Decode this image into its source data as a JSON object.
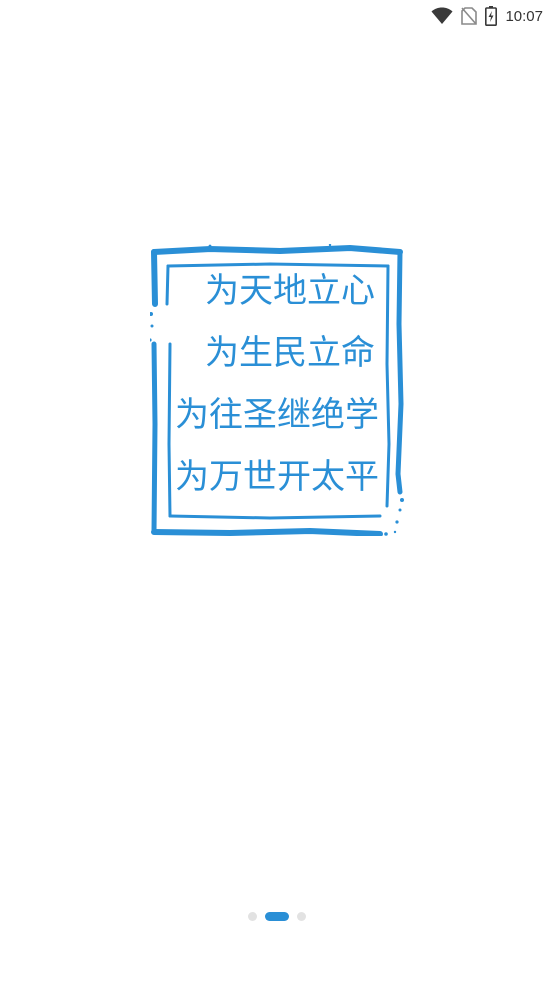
{
  "status_bar": {
    "time": "10:07",
    "icons": [
      "wifi-icon",
      "no-sim-icon",
      "battery-charging-icon"
    ]
  },
  "stamp": {
    "color": "#2a8fd6",
    "lines": [
      "为天地立心",
      "为生民立命",
      "为往圣继绝学",
      "为万世开太平"
    ]
  },
  "pager": {
    "page_count": 3,
    "active_index": 1,
    "active_color": "#2a8fd6",
    "inactive_color": "#e2e2e2"
  }
}
